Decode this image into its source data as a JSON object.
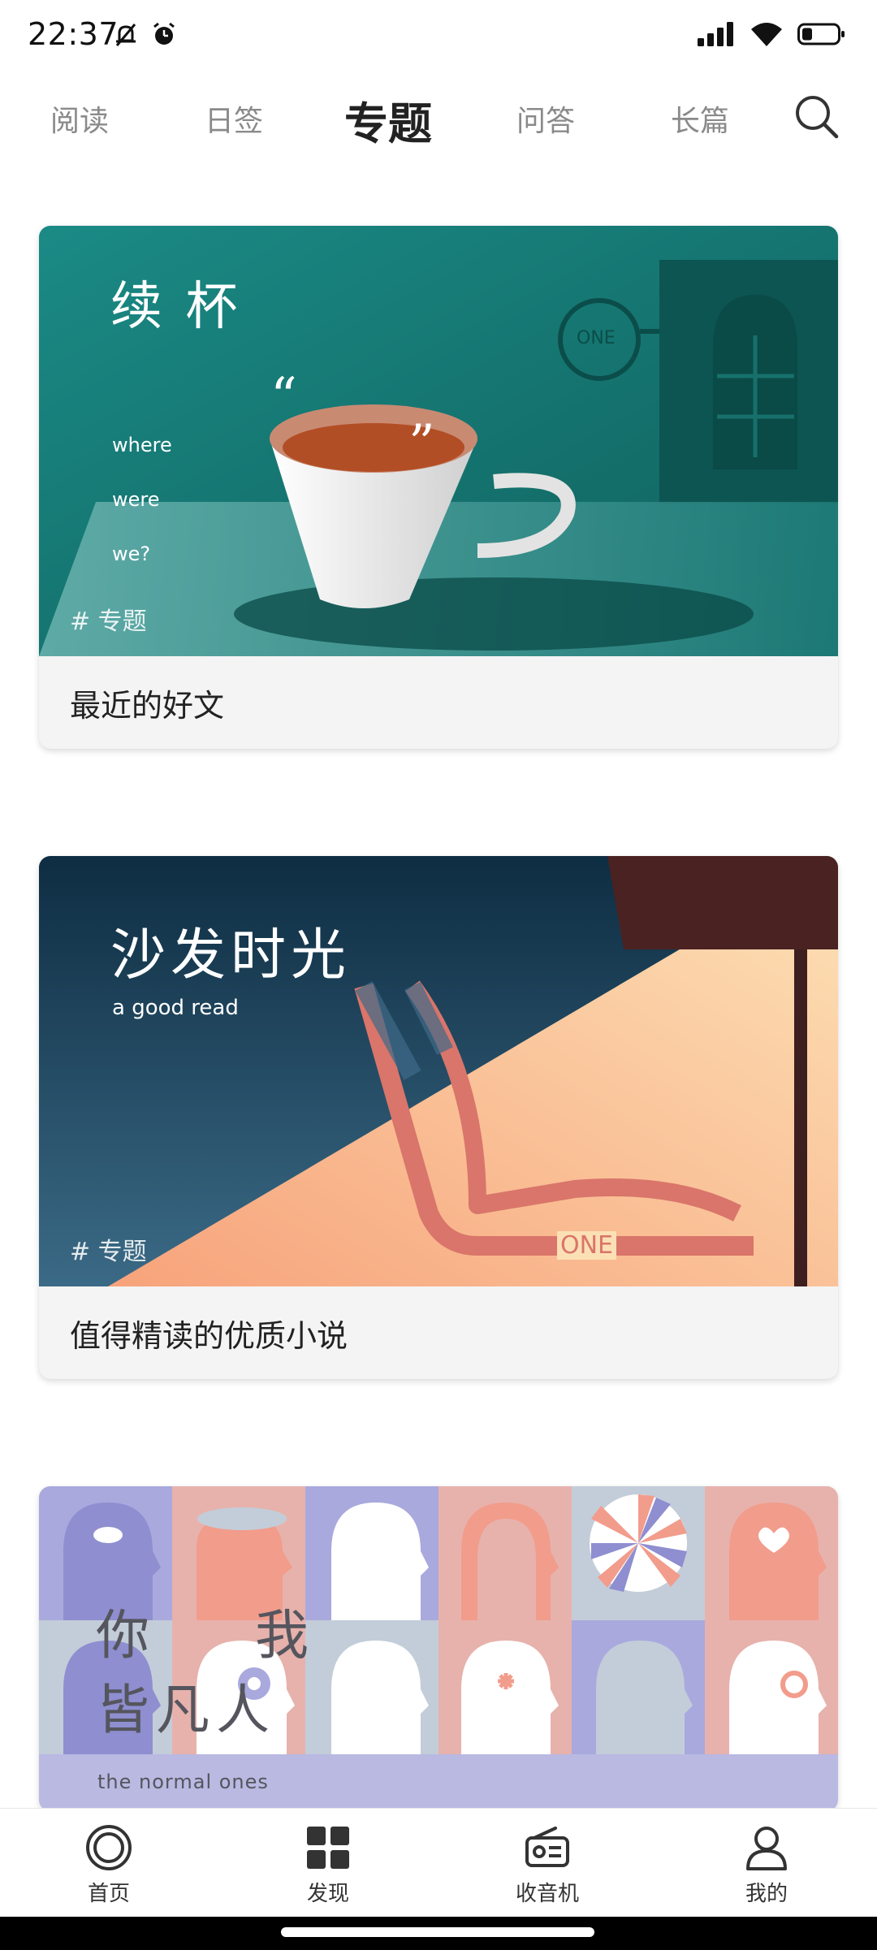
{
  "status_bar": {
    "time": "22:37",
    "icons_left": [
      "mute-bell-icon",
      "alarm-icon"
    ],
    "icons_right": [
      "signal-icon",
      "wifi-icon",
      "battery-icon"
    ]
  },
  "top_nav": {
    "tabs": [
      {
        "label": "阅读",
        "active": false
      },
      {
        "label": "日签",
        "active": false
      },
      {
        "label": "专题",
        "active": true
      },
      {
        "label": "问答",
        "active": false
      },
      {
        "label": "长篇",
        "active": false
      }
    ],
    "search_icon": "search-icon"
  },
  "cards": [
    {
      "image_title": "续 杯",
      "image_lines": [
        "where",
        "were",
        "we?"
      ],
      "image_logo": "ONE",
      "tag": "# 专题",
      "caption": "最近的好文",
      "colors": {
        "bg": "#1e8580",
        "table": "#5fa8a6"
      }
    },
    {
      "image_title": "沙发时光",
      "image_subtitle": "a good read",
      "image_logo": "ONE",
      "tag": "# 专题",
      "caption": "值得精读的优质小说",
      "colors": {
        "dark": "#22455e",
        "light": "#fcd6a6",
        "chair": "#d9756a"
      }
    },
    {
      "image_title_line1_a": "你",
      "image_title_line1_b": "我",
      "image_title_line2": "皆凡人",
      "image_subtitle": "the normal ones",
      "colors": {
        "lilac": "#a9a9de",
        "pink": "#e7b2ac",
        "grey": "#c3cdd9"
      }
    }
  ],
  "bottom_nav": {
    "items": [
      {
        "label": "首页",
        "icon": "home-circle-icon"
      },
      {
        "label": "发现",
        "icon": "discover-grid-icon"
      },
      {
        "label": "收音机",
        "icon": "radio-icon"
      },
      {
        "label": "我的",
        "icon": "profile-icon"
      }
    ]
  }
}
